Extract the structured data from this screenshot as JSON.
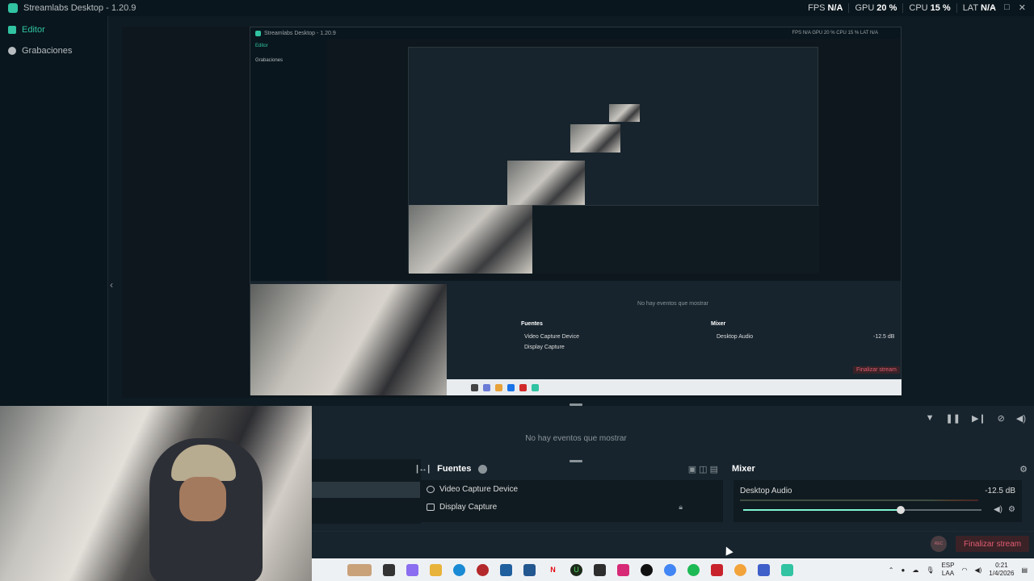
{
  "titlebar": {
    "app_title": "Streamlabs Desktop - 1.20.9",
    "perf": [
      {
        "label": "FPS",
        "value": "N/A"
      },
      {
        "label": "GPU",
        "value": "20 %"
      },
      {
        "label": "CPU",
        "value": "15 %"
      },
      {
        "label": "LAT",
        "value": "N/A"
      }
    ],
    "window_controls": [
      "–",
      "□",
      "✕"
    ]
  },
  "sidebar": {
    "items": [
      {
        "label": "Editor",
        "icon": "editor-icon",
        "active": true
      },
      {
        "label": "Grabaciones",
        "icon": "recordings-icon",
        "active": false
      }
    ]
  },
  "nested": {
    "app_title": "Streamlabs Desktop - 1.20.9",
    "perf": "FPS N/A  GPU 20 %  CPU 15 %  LAT N/A",
    "sidebar": [
      "Editor",
      "Grabaciones"
    ],
    "no_events": "No hay eventos que mostrar",
    "fuentes": "Fuentes",
    "mixer": "Mixer",
    "sources": [
      "Video Capture Device",
      "Display Capture"
    ],
    "desktop_audio": "Desktop Audio",
    "db": "-12.5 dB",
    "stream_btn": "Finalizar stream"
  },
  "events": {
    "no_events": "No hay eventos que mostrar",
    "toolbar_icons": [
      "filter-icon",
      "pause-icon",
      "skip-icon",
      "mute-notifications-icon",
      "volume-icon"
    ]
  },
  "fuentes": {
    "title": "Fuentes",
    "sources": [
      {
        "name": "Video Capture Device",
        "icon": "webcam-icon"
      },
      {
        "name": "Display Capture",
        "icon": "monitor-icon"
      }
    ]
  },
  "mixer": {
    "title": "Mixer",
    "channel": "Desktop Audio",
    "db": "-12.5 dB",
    "volume_fraction": 0.66
  },
  "footer": {
    "rec_label": "REC",
    "stream_button": "Finalizar stream"
  },
  "taskbar": {
    "language": "ESP",
    "language_sub": "LAA",
    "time": "0:21",
    "date": "1/4/2026"
  },
  "colors": {
    "accent": "#31c3a2",
    "stream_red": "#e25d70"
  }
}
